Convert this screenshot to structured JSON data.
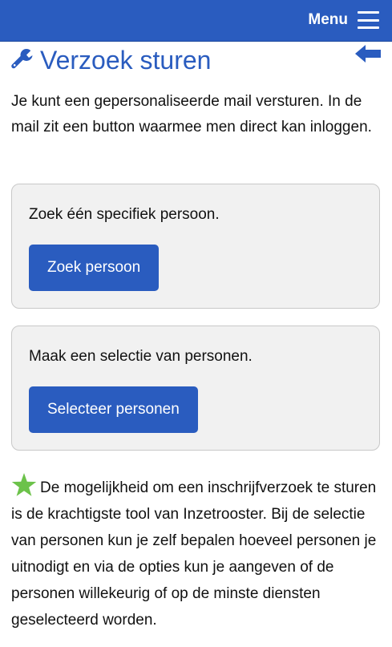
{
  "header": {
    "menu_label": "Menu",
    "menu_icon": "hamburger-icon",
    "background_color": "#2a5cbf"
  },
  "page": {
    "title": "Verzoek sturen",
    "title_icon": "wrench-icon",
    "back_icon": "arrow-left-icon",
    "accent_color": "#2a5cbf"
  },
  "intro": {
    "text": "Je kunt een gepersonaliseerde mail versturen. In de mail zit een button waarmee men direct kan inloggen."
  },
  "cards": [
    {
      "text": "Zoek één specifiek persoon.",
      "button_label": "Zoek persoon"
    },
    {
      "text": "Maak een selectie van personen.",
      "button_label": "Selecteer personen"
    }
  ],
  "tip": {
    "icon": "star-icon",
    "icon_color": "#6cc24a",
    "text": "De mogelijkheid om een inschrijfverzoek te sturen is de krachtigste tool van Inzetrooster. Bij de selectie van personen kun je zelf bepalen hoeveel personen je uitnodigt en via de opties kun je aangeven of de personen willekeurig of op de minste diensten geselecteerd worden."
  }
}
